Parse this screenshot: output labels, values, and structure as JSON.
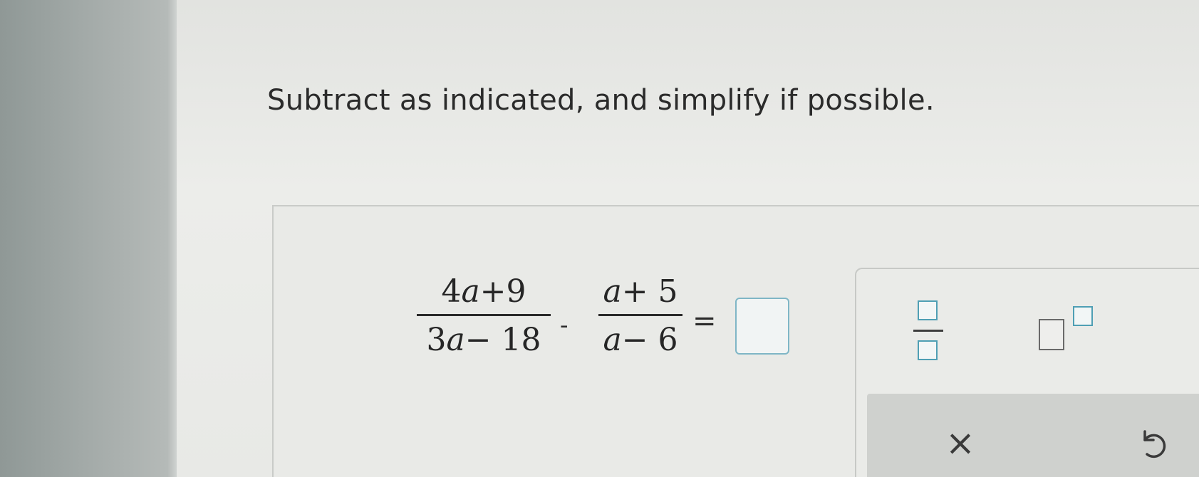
{
  "question": {
    "text": "Subtract as indicated, and simplify if possible."
  },
  "expression": {
    "frac1": {
      "numerator_parts": [
        "4",
        "a",
        "+9"
      ],
      "denominator_parts": [
        "3",
        "a",
        "− 18"
      ]
    },
    "operator": "-",
    "frac2": {
      "numerator_parts": [
        "a",
        "+ 5"
      ],
      "denominator_parts": [
        "a",
        "− 6"
      ]
    },
    "equals": "="
  },
  "answer": {
    "value": ""
  },
  "toolbox": {
    "tools": [
      {
        "name": "fraction-tool",
        "icon": "fraction-template-icon"
      },
      {
        "name": "exponent-tool",
        "icon": "superscript-template-icon"
      }
    ],
    "actions": {
      "clear_label": "×",
      "undo_icon": "undo-icon"
    }
  },
  "colors": {
    "input_border": "#7fb6c6",
    "template_square": "#4f9fb4",
    "text": "#2b2b2b"
  }
}
